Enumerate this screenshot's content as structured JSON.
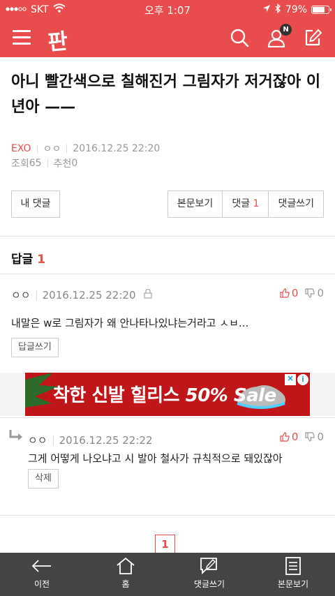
{
  "status_bar": {
    "carrier": "SKT",
    "time": "오후 1:07",
    "battery": "79%",
    "battery_level": 0.79
  },
  "header": {
    "logo_text": "판",
    "notification_badge": "N",
    "icons": [
      "menu-icon",
      "search-icon",
      "user-icon",
      "edit-icon"
    ]
  },
  "post": {
    "title": "아니 빨간색으로 칠해진거 그림자가 저거잖아 이년아 ——",
    "category": "EXO",
    "author": "ㅇㅇ",
    "datetime": "2016.12.25 22:20",
    "views_label": "조회",
    "views": "65",
    "recommend_label": "추천",
    "recommend": "0"
  },
  "buttons": {
    "my_comments": "내 댓글",
    "view_body": "본문보기",
    "comments": "댓글",
    "comments_count": "1",
    "write_comment": "댓글쓰기"
  },
  "replies": {
    "title": "답글",
    "count": "1"
  },
  "comments": [
    {
      "author": "ㅇㅇ",
      "datetime": "2016.12.25 22:20",
      "up": "0",
      "down": "0",
      "body": "내말은 w로 그림자가 왜 안나타나있냐는거라고 ㅅㅂ...",
      "action": "답글쓰기"
    },
    {
      "author": "ㅇㅇ",
      "datetime": "2016.12.25 22:22",
      "up": "0",
      "down": "0",
      "body": "그게 어떻게 나오냐고 시 발아 철사가 규칙적으로 돼있잖아",
      "action": "삭제"
    }
  ],
  "ad": {
    "text_main": "착한 신발 힐리스",
    "text_sale": "50% Sale",
    "choice_icon": "i"
  },
  "pagination": {
    "current": "1"
  },
  "colors": {
    "brand": "#e84c4c",
    "tab_bar": "#444444"
  },
  "tabbar": {
    "items": [
      {
        "label": "이전",
        "icon": "back-arrow-icon"
      },
      {
        "label": "홈",
        "icon": "home-icon"
      },
      {
        "label": "댓글쓰기",
        "icon": "comment-write-icon"
      },
      {
        "label": "본문보기",
        "icon": "document-icon"
      }
    ]
  }
}
